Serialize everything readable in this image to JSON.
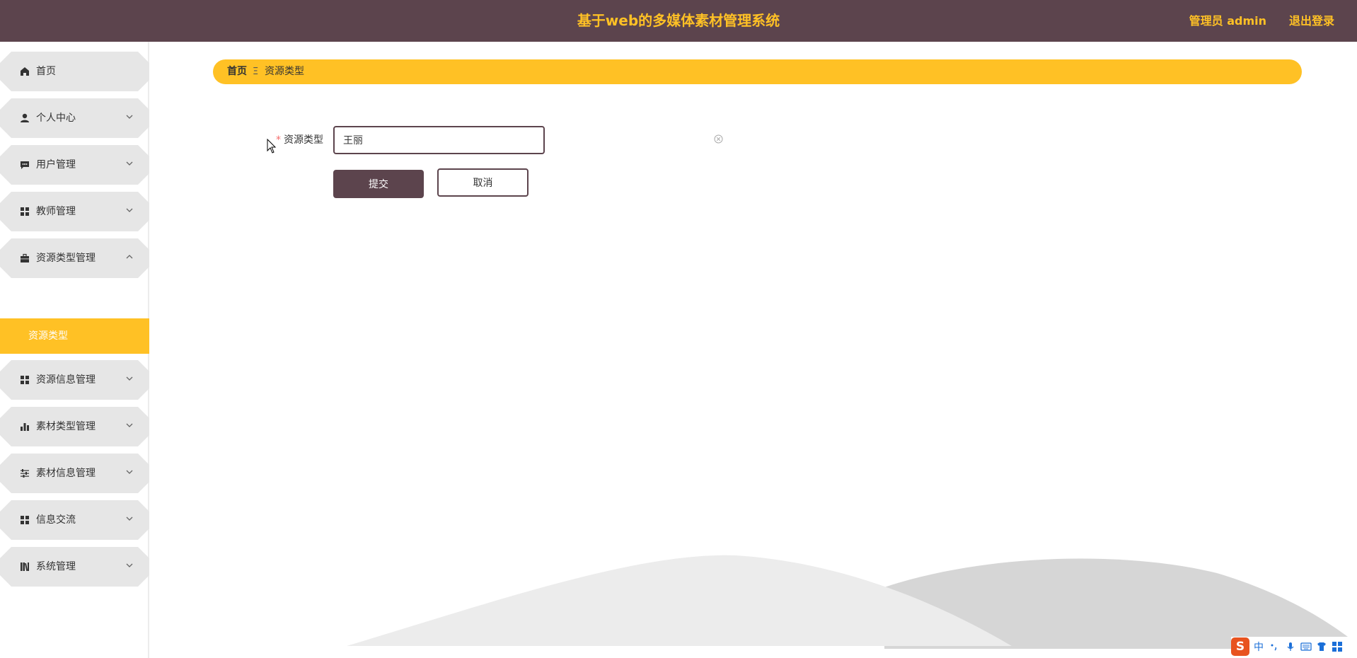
{
  "header": {
    "title": "基于web的多媒体素材管理系统",
    "user_label": "管理员 admin",
    "logout_label": "退出登录"
  },
  "sidebar": {
    "items": [
      {
        "label": "首页",
        "icon": "home-icon"
      },
      {
        "label": "个人中心",
        "icon": "user-icon"
      },
      {
        "label": "用户管理",
        "icon": "chat-icon"
      },
      {
        "label": "教师管理",
        "icon": "grid-icon"
      },
      {
        "label": "资源类型管理",
        "icon": "briefcase-icon",
        "expanded": true
      },
      {
        "label": "资源信息管理",
        "icon": "grid-icon"
      },
      {
        "label": "素材类型管理",
        "icon": "bar-chart-icon"
      },
      {
        "label": "素材信息管理",
        "icon": "sliders-icon"
      },
      {
        "label": "信息交流",
        "icon": "grid-icon"
      },
      {
        "label": "系统管理",
        "icon": "book-icon"
      }
    ],
    "active_subitem": "资源类型"
  },
  "breadcrumb": {
    "home": "首页",
    "separator": "Ξ",
    "current": "资源类型"
  },
  "form": {
    "field_label": "资源类型",
    "required_mark": "*",
    "field_value": "王丽",
    "submit_label": "提交",
    "cancel_label": "取消"
  },
  "ime": {
    "logo": "S",
    "mode": "中"
  },
  "colors": {
    "header_bg": "#5c444d",
    "accent": "#ffc125",
    "menu_bg": "#e6e6e6"
  }
}
